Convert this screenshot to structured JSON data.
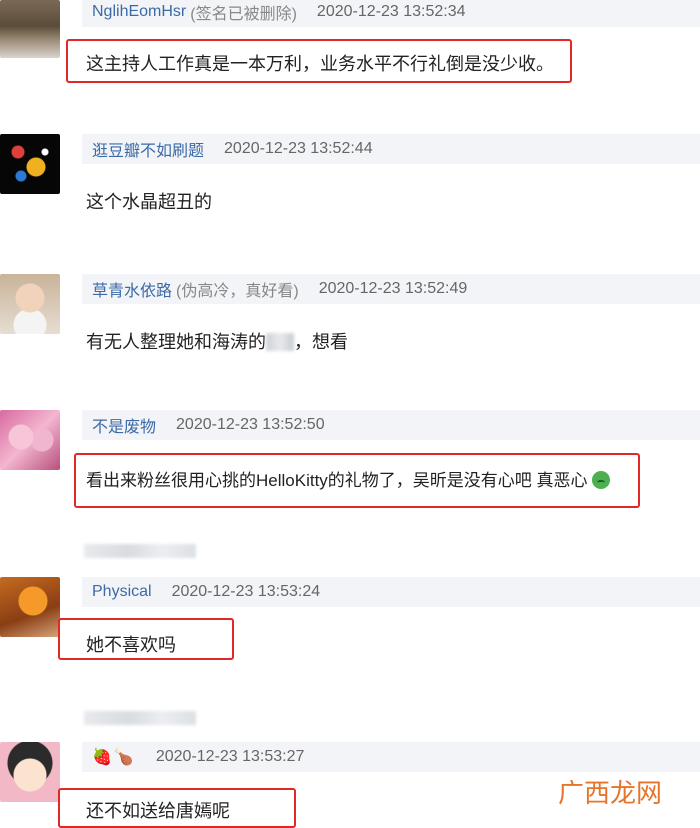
{
  "comments": [
    {
      "user": "NglihEomHsr",
      "signature": "(签名已被删除)",
      "time": "2020-12-23 13:52:34",
      "text": "这主持人工作真是一本万利，业务水平不行礼倒是没少收。"
    },
    {
      "user": "逛豆瓣不如刷题",
      "time": "2020-12-23 13:52:44",
      "text": "这个水晶超丑的"
    },
    {
      "user": "草青水依路",
      "signature": "(伪高冷，真好看)",
      "time": "2020-12-23 13:52:49",
      "text_before": "有无人整理她和海涛的",
      "text_after": "，想看"
    },
    {
      "user": "不是废物",
      "time": "2020-12-23 13:52:50",
      "text": "看出来粉丝很用心挑的HelloKitty的礼物了，吴昕是没有心吧 真恶心"
    },
    {
      "user": "Physical",
      "time": "2020-12-23 13:53:24",
      "text": "她不喜欢吗"
    },
    {
      "user_emoji": "🍓🍗",
      "time": "2020-12-23 13:53:27",
      "text": "还不如送给唐嫣呢"
    }
  ],
  "watermark": "广西龙网",
  "colors": {
    "highlight": "#e32626",
    "username": "#3c6aa6",
    "meta_bg": "#f2f4f7"
  }
}
